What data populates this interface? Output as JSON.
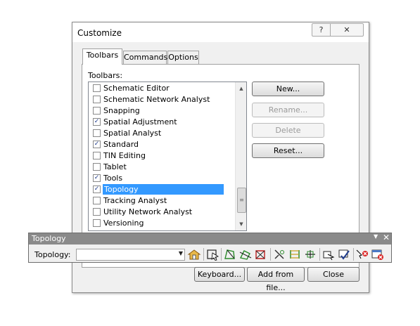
{
  "dialog": {
    "title": "Customize",
    "help_glyph": "?",
    "close_glyph": "✕",
    "tabs": [
      {
        "label": "Toolbars",
        "active": true
      },
      {
        "label": "Commands",
        "active": false
      },
      {
        "label": "Options",
        "active": false
      }
    ],
    "toolbars_label": "Toolbars:",
    "toolbars_list": [
      {
        "label": "Schematic Editor",
        "checked": false,
        "selected": false
      },
      {
        "label": "Schematic Network Analyst",
        "checked": false,
        "selected": false
      },
      {
        "label": "Snapping",
        "checked": false,
        "selected": false
      },
      {
        "label": "Spatial Adjustment",
        "checked": true,
        "selected": false
      },
      {
        "label": "Spatial Analyst",
        "checked": false,
        "selected": false
      },
      {
        "label": "Standard",
        "checked": true,
        "selected": false
      },
      {
        "label": "TIN Editing",
        "checked": false,
        "selected": false
      },
      {
        "label": "Tablet",
        "checked": false,
        "selected": false
      },
      {
        "label": "Tools",
        "checked": true,
        "selected": false
      },
      {
        "label": "Topology",
        "checked": true,
        "selected": true
      },
      {
        "label": "Tracking Analyst",
        "checked": false,
        "selected": false
      },
      {
        "label": "Utility Network Analyst",
        "checked": false,
        "selected": false
      },
      {
        "label": "Versioning",
        "checked": false,
        "selected": false
      }
    ],
    "buttons": {
      "new": "New...",
      "rename": "Rename...",
      "delete": "Delete",
      "reset": "Reset...",
      "keyboard": "Keyboard...",
      "add_from_file": "Add from file...",
      "close": "Close"
    },
    "scroll": {
      "up_glyph": "▲",
      "down_glyph": "▼",
      "thumb_glyph": "≡"
    }
  },
  "floating_toolbar": {
    "title": "Topology",
    "dropdown_glyph": "▼",
    "close_glyph": "✕",
    "combo_label": "Topology:",
    "combo_value": "",
    "combo_arrow": "▼",
    "icons": [
      "map-topology-icon",
      "topology-edit-tool-icon",
      "construct-features-icon",
      "planarize-lines-icon",
      "construct-polygons-icon",
      "split-polygons-icon",
      "align-edge-icon",
      "generalize-edge-icon",
      "reshape-edge-icon",
      "validate-topology-icon",
      "fix-topology-error-icon",
      "error-inspector-icon",
      "error-inspector-window-icon"
    ]
  },
  "colors": {
    "selection": "#3399ff",
    "toolbar_title_bar": "#8a8a8a",
    "dialog_bg": "#f0f0f0"
  }
}
